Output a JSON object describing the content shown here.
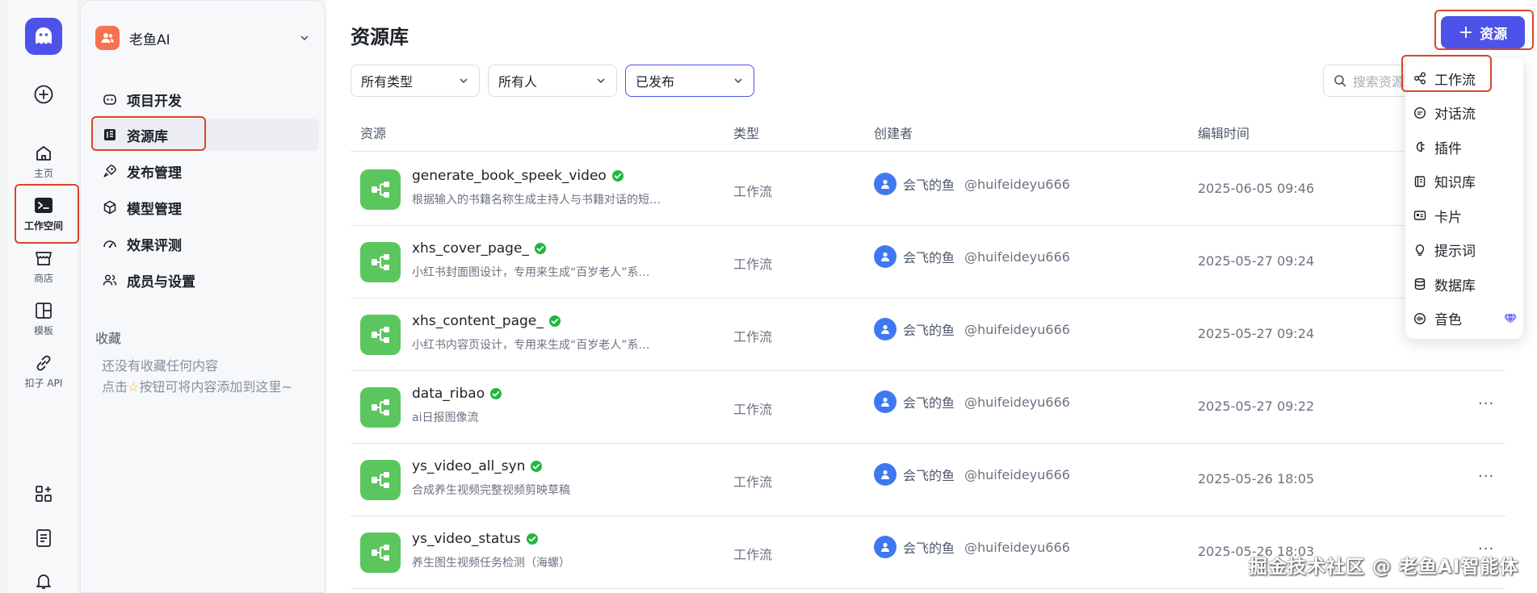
{
  "rail": {
    "items": [
      {
        "label": "主页"
      },
      {
        "label": "工作空间"
      },
      {
        "label": "商店"
      },
      {
        "label": "模板"
      },
      {
        "label": "扣子 API"
      }
    ]
  },
  "workspace": {
    "name": "老鱼AI"
  },
  "sidebar": {
    "items": [
      {
        "label": "项目开发"
      },
      {
        "label": "资源库"
      },
      {
        "label": "发布管理"
      },
      {
        "label": "模型管理"
      },
      {
        "label": "效果评测"
      },
      {
        "label": "成员与设置"
      }
    ],
    "favorites_title": "收藏",
    "favorites_empty_line1": "还没有收藏任何内容",
    "favorites_empty_line2_pre": "点击",
    "favorites_empty_line2_post": "按钮可将内容添加到这里~"
  },
  "main": {
    "title": "资源库",
    "add_button": "资源",
    "filters": [
      "所有类型",
      "所有人",
      "已发布"
    ],
    "search_placeholder": "搜索资源",
    "columns": [
      "资源",
      "类型",
      "创建者",
      "编辑时间"
    ],
    "rows": [
      {
        "name": "generate_book_speek_video",
        "desc": "根据输入的书籍名称生成主持人与书籍对话的短…",
        "type": "工作流",
        "creator": "会飞的鱼",
        "handle": "@huifeideyu666",
        "time": "2025-06-05 09:46",
        "more": ""
      },
      {
        "name": "xhs_cover_page_",
        "desc": "小红书封面图设计，专用来生成“百岁老人”系…",
        "type": "工作流",
        "creator": "会飞的鱼",
        "handle": "@huifeideyu666",
        "time": "2025-05-27 09:24",
        "more": ""
      },
      {
        "name": "xhs_content_page_",
        "desc": "小红书内容页设计，专用来生成“百岁老人”系…",
        "type": "工作流",
        "creator": "会飞的鱼",
        "handle": "@huifeideyu666",
        "time": "2025-05-27 09:24",
        "more": ""
      },
      {
        "name": "data_ribao",
        "desc": "ai日报图像流",
        "type": "工作流",
        "creator": "会飞的鱼",
        "handle": "@huifeideyu666",
        "time": "2025-05-27 09:22",
        "more": "···"
      },
      {
        "name": "ys_video_all_syn",
        "desc": "合成养生视频完整视频剪映草稿",
        "type": "工作流",
        "creator": "会飞的鱼",
        "handle": "@huifeideyu666",
        "time": "2025-05-26 18:05",
        "more": "···"
      },
      {
        "name": "ys_video_status",
        "desc": "养生图生视频任务检测（海螺）",
        "type": "工作流",
        "creator": "会飞的鱼",
        "handle": "@huifeideyu666",
        "time": "2025-05-26 18:03",
        "more": "···"
      }
    ]
  },
  "menu": {
    "items": [
      {
        "label": "工作流",
        "icon": "workflow-icon"
      },
      {
        "label": "对话流",
        "icon": "chatflow-icon"
      },
      {
        "label": "插件",
        "icon": "plugin-icon"
      },
      {
        "label": "知识库",
        "icon": "knowledge-icon"
      },
      {
        "label": "卡片",
        "icon": "card-icon"
      },
      {
        "label": "提示词",
        "icon": "prompt-icon"
      },
      {
        "label": "数据库",
        "icon": "database-icon"
      },
      {
        "label": "音色",
        "icon": "voice-icon"
      }
    ]
  },
  "watermark": "掘金技术社区 @ 老鱼AI智能体",
  "colors": {
    "accent": "#4d53e8",
    "resource_icon": "#5cc65e",
    "highlight": "#d9452b",
    "verified": "#1fb83f"
  }
}
